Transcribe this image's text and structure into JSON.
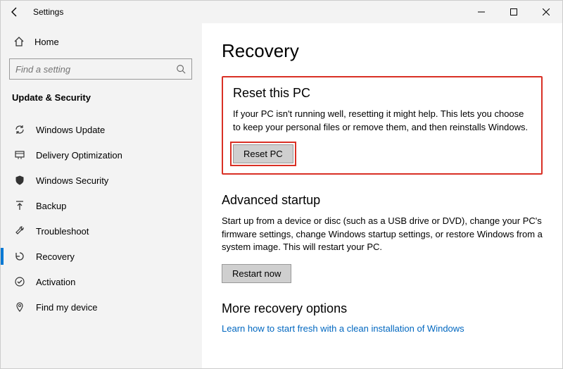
{
  "titlebar": {
    "app_title": "Settings"
  },
  "home": {
    "label": "Home"
  },
  "search": {
    "placeholder": "Find a setting"
  },
  "section_label": "Update & Security",
  "nav": [
    {
      "label": "Windows Update"
    },
    {
      "label": "Delivery Optimization"
    },
    {
      "label": "Windows Security"
    },
    {
      "label": "Backup"
    },
    {
      "label": "Troubleshoot"
    },
    {
      "label": "Recovery"
    },
    {
      "label": "Activation"
    },
    {
      "label": "Find my device"
    }
  ],
  "page": {
    "title": "Recovery",
    "reset": {
      "title": "Reset this PC",
      "body": "If your PC isn't running well, resetting it might help. This lets you choose to keep your personal files or remove them, and then reinstalls Windows.",
      "button": "Reset PC"
    },
    "advanced": {
      "title": "Advanced startup",
      "body": "Start up from a device or disc (such as a USB drive or DVD), change your PC's firmware settings, change Windows startup settings, or restore Windows from a system image. This will restart your PC.",
      "button": "Restart now"
    },
    "more": {
      "title": "More recovery options",
      "link": "Learn how to start fresh with a clean installation of Windows"
    }
  }
}
